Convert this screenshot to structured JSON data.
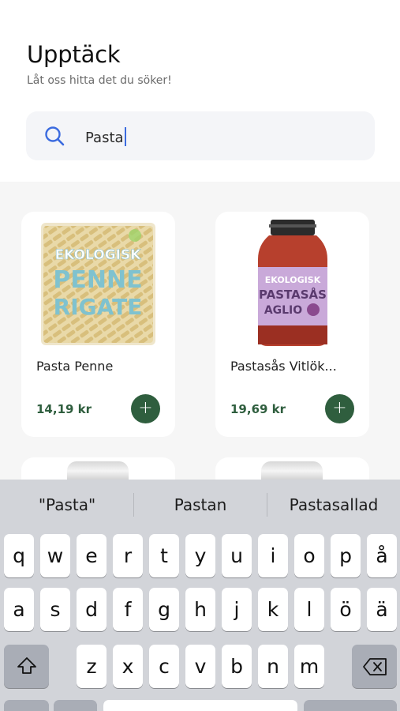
{
  "header": {
    "title": "Upptäck",
    "subtitle": "Låt oss hitta det du söker!"
  },
  "search": {
    "value": "Pasta"
  },
  "products": [
    {
      "name": "Pasta Penne",
      "price": "14,19 kr",
      "package_text": [
        "EKOLOGISK",
        "PENNE",
        "RIGATE"
      ]
    },
    {
      "name": "Pastasås Vitlök...",
      "price": "19,69 kr",
      "package_text": [
        "EKOLOGISK",
        "PASTASÅS",
        "AGLIO"
      ]
    }
  ],
  "add_label": "+",
  "keyboard": {
    "suggestions": [
      "\"Pasta\"",
      "Pastan",
      "Pastasallad"
    ],
    "row1": [
      "q",
      "w",
      "e",
      "r",
      "t",
      "y",
      "u",
      "i",
      "o",
      "p",
      "å"
    ],
    "row2": [
      "a",
      "s",
      "d",
      "f",
      "g",
      "h",
      "j",
      "k",
      "l",
      "ö",
      "ä"
    ],
    "row3": [
      "z",
      "x",
      "c",
      "v",
      "b",
      "n",
      "m"
    ],
    "icons": {
      "shift": "shift-icon",
      "backspace": "backspace-icon"
    }
  },
  "colors": {
    "accent": "#2f5e3e",
    "search_icon": "#3b6bdf"
  }
}
